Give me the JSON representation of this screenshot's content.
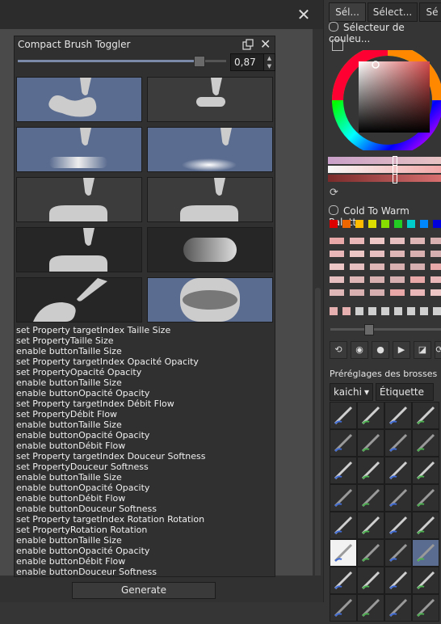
{
  "window": {
    "close_symbol": "✕"
  },
  "docker": {
    "title": "Compact Brush Toggler",
    "slider_value": "0,87",
    "slider_level": 0.87,
    "tiles": [
      {
        "name": "size-blob",
        "active": true,
        "style": "blue"
      },
      {
        "name": "size-small",
        "active": false,
        "style": "gray"
      },
      {
        "name": "opacity-gradient",
        "active": true,
        "style": "blue"
      },
      {
        "name": "opacity-glow",
        "active": true,
        "style": "blue"
      },
      {
        "name": "flow-1",
        "active": false,
        "style": "gray"
      },
      {
        "name": "flow-2",
        "active": false,
        "style": "gray"
      },
      {
        "name": "softness-1",
        "active": false,
        "style": "dark"
      },
      {
        "name": "softness-pill",
        "active": false,
        "style": "dark"
      },
      {
        "name": "rotation-brush",
        "active": false,
        "style": "dark"
      },
      {
        "name": "rotation-oval",
        "active": true,
        "style": "blue"
      }
    ],
    "log_lines": [
      "set Property targetIndex Taille Size",
      "set PropertyTaille Size",
      "enable buttonTaille Size",
      "set Property targetIndex Opacité Opacity",
      "set PropertyOpacité Opacity",
      "enable buttonTaille Size",
      "enable buttonOpacité Opacity",
      "set Property targetIndex Débit Flow",
      "set PropertyDébit Flow",
      "enable buttonTaille Size",
      "enable buttonOpacité Opacity",
      "enable buttonDébit Flow",
      "set Property targetIndex Douceur Softness",
      "set PropertyDouceur Softness",
      "enable buttonTaille Size",
      "enable buttonOpacité Opacity",
      "enable buttonDébit Flow",
      "enable buttonDouceur Softness",
      "set Property targetIndex Rotation Rotation",
      "set PropertyRotation Rotation",
      "enable buttonTaille Size",
      "enable buttonOpacité Opacity",
      "enable buttonDébit Flow",
      "enable buttonDouceur Softness"
    ],
    "generate_label": "Generate"
  },
  "right_panel": {
    "tabs": [
      "Sél...",
      "Sélect...",
      "Sé"
    ],
    "color_selector_title": "Sélecteur de couleu...",
    "palette_title": "Cold To Warm Palette",
    "presets_title": "Préréglages des brosses",
    "preset_filter": "kaichi",
    "tag_label": "Étiquette",
    "accent_colors": {
      "wheel_sv_top": "#d54a4a",
      "bar1": "#e8c3c3",
      "bar2": "#f2a7a7",
      "bar3": "#d97070"
    }
  }
}
